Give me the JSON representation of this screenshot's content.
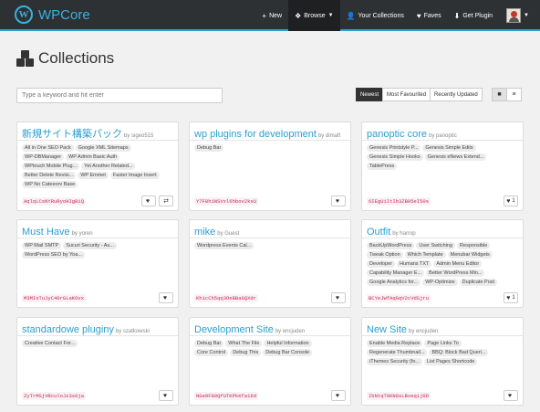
{
  "nav": {
    "brand": "WPCore",
    "brand_logo": "W",
    "items": [
      {
        "icon": "plus-icon",
        "glyph": "+",
        "label": "New"
      },
      {
        "icon": "cubes-icon",
        "glyph": "❖",
        "label": "Browse"
      },
      {
        "icon": "user-icon",
        "glyph": "👤",
        "label": "Your Collections"
      },
      {
        "icon": "heart-icon",
        "glyph": "♥",
        "label": "Faves"
      },
      {
        "icon": "download-icon",
        "glyph": "⬇",
        "label": "Get Plugin"
      }
    ]
  },
  "page": {
    "title": "Collections"
  },
  "search": {
    "placeholder": "Type a keyword and hit enter"
  },
  "sort": {
    "options": [
      "Newest",
      "Most Favourited",
      "Recently Updated"
    ],
    "active": "Newest"
  },
  "view": {
    "grid_glyph": "■",
    "list_glyph": "≡"
  },
  "colors": {
    "accent": "#2aa1d3",
    "navbar": "#2e3133",
    "code": "#c7254e"
  },
  "cards": [
    {
      "title": "新規サイト構築パック",
      "by": "by sigeo515",
      "tags": [
        "All in One SEO Pack",
        "Google XML Sitemaps",
        "WP-DBManager",
        "WP Admin Basic Auth",
        "WPtouch Mobile Plug...",
        "Yet Another Related...",
        "Better Delete Revisi...",
        "WP Emmet",
        "Faster Image Insert",
        "WP No Cateeorv Base"
      ],
      "code": "AqlqLCsNYRuRyoHIgBiQ",
      "heart": "♥",
      "count": "",
      "extra": "⇄"
    },
    {
      "title": "wp plugins for development",
      "by": "by dimaft",
      "tags": [
        "Debug Bar"
      ],
      "code": "Y7F8h1NSVxl6hbov2ksU",
      "heart": "♥",
      "count": ""
    },
    {
      "title": "panoptic core",
      "by": "by panoptic",
      "tags": [
        "Genesis Printstyle P...",
        "Genesis Simple Edits",
        "Genesis Simple Hooks",
        "Genesis eNews Extend...",
        "TablePress"
      ],
      "code": "6IEgUiItIb3ZB05eI50s",
      "heart": "♥",
      "count": "1"
    },
    {
      "title": "Must Have",
      "by": "by yoren",
      "tags": [
        "WP Mail SMTP",
        "Sucuri Security - Au...",
        "WordPress SEO by Yoa..."
      ],
      "code": "M3MIoTuJyC40rGLaKOvx",
      "heart": "♥",
      "count": ""
    },
    {
      "title": "mike",
      "by": "by Guest",
      "tags": [
        "Wordpress Events Cal..."
      ],
      "code": "KhicCh5qq3OeBBaGQXdr",
      "heart": "♥",
      "count": ""
    },
    {
      "title": "Outfit",
      "by": "by harrop",
      "tags": [
        "BackUpWordPress",
        "User Switching",
        "Responsible",
        "Tweak Option",
        "Which Template",
        "Menubar Widgets",
        "Developer",
        "Humans TXT",
        "Admin Menu Editor",
        "Capability Manager E...",
        "Better WordPress Min...",
        "Google Analytics for...",
        "WP-Optimize",
        "Duplicate Post"
      ],
      "code": "BCYeJWfAqGqV2cVdSjru",
      "heart": "♥",
      "count": "1"
    },
    {
      "title": "standardowe pluginy",
      "by": "by szatkowski",
      "tags": [
        "Creative Contact For..."
      ],
      "code": "ZyTrMSjVRculoJz3s0ja",
      "heart": "♥",
      "count": ""
    },
    {
      "title": "Development Site",
      "by": "by encjuden",
      "tags": [
        "Debug Bar",
        "What The File",
        "Helpful Information",
        "Core Control",
        "Debug This",
        "Debug Bar Console"
      ],
      "code": "NGe9F80QfUTKPkKfa16d",
      "heart": "♥",
      "count": ""
    },
    {
      "title": "New Site",
      "by": "by encjuden",
      "tags": [
        "Enable Media Replace",
        "Page Links To",
        "Regenerate Thumbnail...",
        "BBQ: Block Bad Queri...",
        "iThemes Security (fo...",
        "List Pages Shortcode"
      ],
      "code": "IbNtqT0KN8sLBveqij0D",
      "heart": "♥",
      "count": ""
    }
  ]
}
